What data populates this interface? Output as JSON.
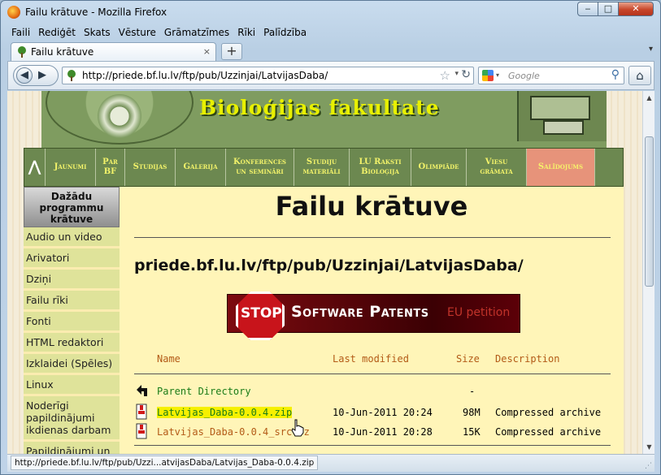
{
  "window": {
    "title": "Failu krātuve - Mozilla Firefox",
    "buttons": {
      "minimize": "‒",
      "maximize": "□",
      "close": "✕"
    }
  },
  "menubar": [
    "Faili",
    "Rediģēt",
    "Skats",
    "Vēsture",
    "Grāmatzīmes",
    "Rīki",
    "Palīdzība"
  ],
  "tab": {
    "title": "Failu krātuve",
    "close": "×",
    "new_tab": "+",
    "list": "▾"
  },
  "navbar": {
    "url": "http://priede.bf.lu.lv/ftp/pub/Uzzinjai/LatvijasDaba/",
    "search_placeholder": "Google",
    "back_glyph": "◀",
    "forward_glyph": "▶",
    "star_glyph": "☆",
    "dropdown_glyph": "▾",
    "reload_glyph": "↻",
    "search_glyph": "⚲",
    "home_glyph": "⌂"
  },
  "banner": {
    "faculty_title": "Bioloģijas fakultate"
  },
  "topnav": [
    {
      "label": "Jaunumi",
      "width": 62
    },
    {
      "label": "Par BF",
      "width": 36
    },
    {
      "label": "Studijas",
      "width": 62
    },
    {
      "label": "Galerija",
      "width": 62
    },
    {
      "label": "Konferences un semināri",
      "width": 84
    },
    {
      "label": "Studiju materiāli",
      "width": 68
    },
    {
      "label": "LU Raksti Bioloģija",
      "width": 76
    },
    {
      "label": "Olimpiāde",
      "width": 68
    },
    {
      "label": "Viesu grāmata",
      "width": 74
    },
    {
      "label": "Salīdojums",
      "width": 84,
      "active": true
    }
  ],
  "topnav_home_glyph": "⋀",
  "sidebar": {
    "title": "Dažādu programmu krātuve",
    "items": [
      "Audio un video",
      "Arivatori",
      "Dziņi",
      "Failu rīki",
      "Fonti",
      "HTML redaktori",
      "Izklaidei (Spēles)",
      "Linux",
      "Noderīgi papildinājumi ikdienas darbam",
      "Papildinājumi un"
    ]
  },
  "main": {
    "heading": "Failu krātuve",
    "path": "priede.bf.lu.lv/ftp/pub/Uzzinjai/LatvijasDaba/",
    "stop_banner": {
      "stop": "STOP",
      "software_patents": "Software Patents",
      "eu_petition": "EU petition"
    }
  },
  "listing": {
    "columns": {
      "name": "Name",
      "last_modified": "Last modified",
      "size": "Size",
      "description": "Description"
    },
    "rows": [
      {
        "name": "Parent Directory",
        "modified": "",
        "size": "-",
        "description": "",
        "icon": "back-icon",
        "state": "normal"
      },
      {
        "name": "Latvijas_Daba-0.0.4.zip",
        "modified": "10-Jun-2011 20:24",
        "size": "98M",
        "description": "Compressed archive",
        "icon": "archive-icon",
        "state": "hover"
      },
      {
        "name": "Latvijas_Daba-0.0.4_src.7z",
        "modified": "10-Jun-2011 20:28",
        "size": "15K",
        "description": "Compressed archive",
        "icon": "archive-icon",
        "state": "visited"
      }
    ]
  },
  "statusbar": {
    "text": "http://priede.bf.lu.lv/ftp/pub/Uzzi...atvijasDaba/Latvijas_Daba-0.0.4.zip"
  },
  "colors": {
    "banner_green": "#7f9c60",
    "title_yellow": "#e8f000",
    "nav_active": "#e7937a",
    "page_bg": "#fff5b8",
    "link_green": "#1b7c18",
    "header_orange": "#b35b17"
  }
}
